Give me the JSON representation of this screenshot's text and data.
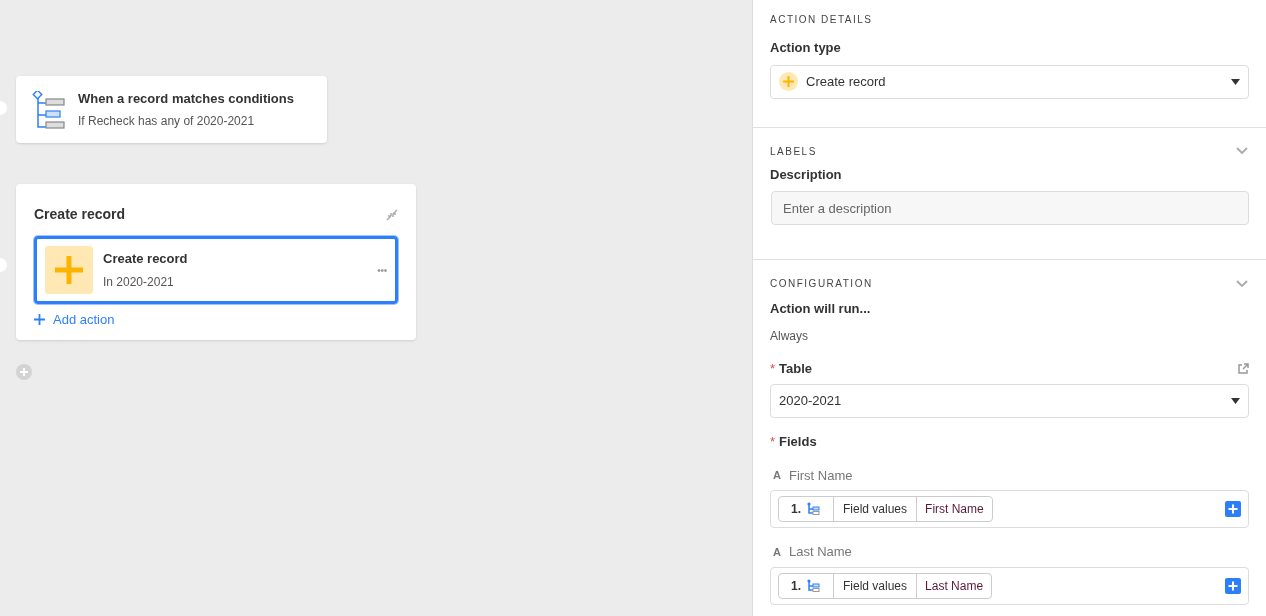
{
  "canvas": {
    "trigger": {
      "title": "When a record matches conditions",
      "subtitle": "If Recheck has any of 2020-2021"
    },
    "action_group": {
      "title": "Create record",
      "action": {
        "title": "Create record",
        "subtitle": "In 2020-2021",
        "selected": true,
        "menu": "•••"
      },
      "add_action": "Add action"
    }
  },
  "panel": {
    "action_details": {
      "heading": "ACTION DETAILS",
      "action_type_label": "Action type",
      "action_type_value": "Create record"
    },
    "labels": {
      "heading": "LABELS",
      "expanded": true,
      "description_label": "Description",
      "description_placeholder": "Enter a description"
    },
    "configuration": {
      "heading": "CONFIGURATION",
      "expanded": true,
      "run_label": "Action will run...",
      "run_value": "Always",
      "table": {
        "label": "Table",
        "required": true,
        "required_mark": "*",
        "value": "2020-2021"
      },
      "fields_label": {
        "label": "Fields",
        "required": true,
        "required_mark": "*"
      },
      "fields": [
        {
          "type_glyph": "A",
          "name": "First Name",
          "token": {
            "step": "1.",
            "source": "Field values",
            "field": "First Name"
          }
        },
        {
          "type_glyph": "A",
          "name": "Last Name",
          "token": {
            "step": "1.",
            "source": "Field values",
            "field": "Last Name"
          }
        }
      ]
    }
  }
}
